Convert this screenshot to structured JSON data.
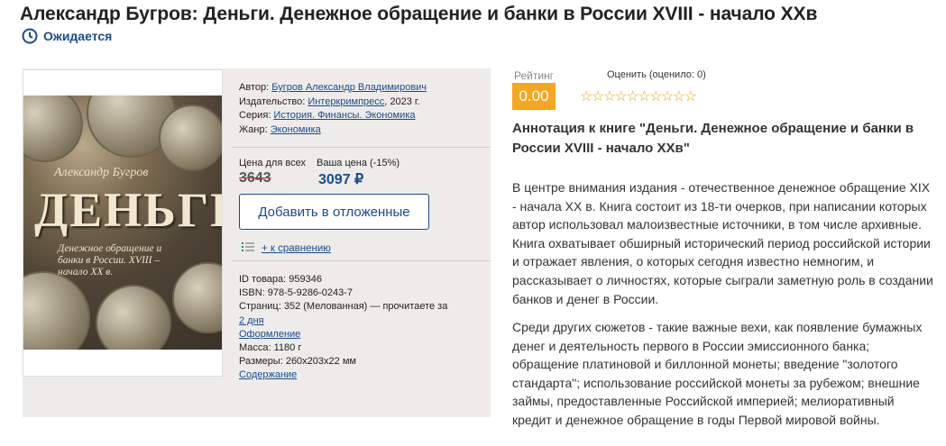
{
  "header": {
    "title": "Александр Бугров: Деньги. Денежное обращение и банки в России XVIII - начало XXв",
    "status": "Ожидается"
  },
  "cover": {
    "author": "Александр Бугров",
    "title": "ДЕНЬГИ",
    "subtitle": "Денежное обращение и банки в России. XVIII – начало XX в."
  },
  "info": {
    "author_label": "Автор:",
    "author": "Бугров Александр Владимирович",
    "publisher_label": "Издательство:",
    "publisher": "Интеркримпресс",
    "publisher_year": ", 2023 г.",
    "series_label": "Серия:",
    "series": "История. Финансы. Экономика",
    "genre_label": "Жанр:",
    "genre": "Экономика"
  },
  "price": {
    "all_label": "Цена для всех",
    "your_label": "Ваша цена (-15%)",
    "old": "3643",
    "new": "3097 ₽",
    "defer_button": "Добавить в отложенные",
    "compare": "+ к сравнению"
  },
  "details": {
    "id": "ID товара: 959346",
    "isbn": "ISBN: 978-5-9286-0243-7",
    "pages": "Страниц: 352 (Мелованная) — прочитаете за",
    "read_time": "2 дня",
    "design": "Оформление",
    "mass": "Масса: 1180 г",
    "size": "Размеры: 260x203x22 мм",
    "contents": "Содержание"
  },
  "rating": {
    "label": "Рейтинг",
    "hint": "Оценить (оценило: 0)",
    "score": "0.00",
    "stars": "☆☆☆☆☆☆☆☆☆☆"
  },
  "annotation": {
    "title": "Аннотация к книге \"Деньги. Денежное обращение и банки в России XVIII - начало XXв\"",
    "p1": "В центре внимания издания - отечественное денежное обращение XIX - начала XX в. Книга состоит из 18-ти очерков, при написании которых автор использовал малоизвестные источники, в том числе архивные. Книга охватывает обширный исторический период российской истории и отражает явления, о которых сегодня известно немногим, и рассказывает о личностях, которые сыграли заметную роль в создании банков и денег в России.",
    "p2": "Среди других сюжетов - такие важные вехи, как появление бумажных денег и деятельность первого в России эмиссионного банка; обращение платиновой и биллонной монеты; введение \"золотого стандарта\"; использование российской монеты за рубежом; внешние займы, предоставленные Российской империей; мелиоративный кредит и денежное обращение в годы Первой мировой войны."
  },
  "colors": {
    "accent": "#1a4a8c",
    "rating": "#f5a623",
    "panel": "#eeecea"
  }
}
